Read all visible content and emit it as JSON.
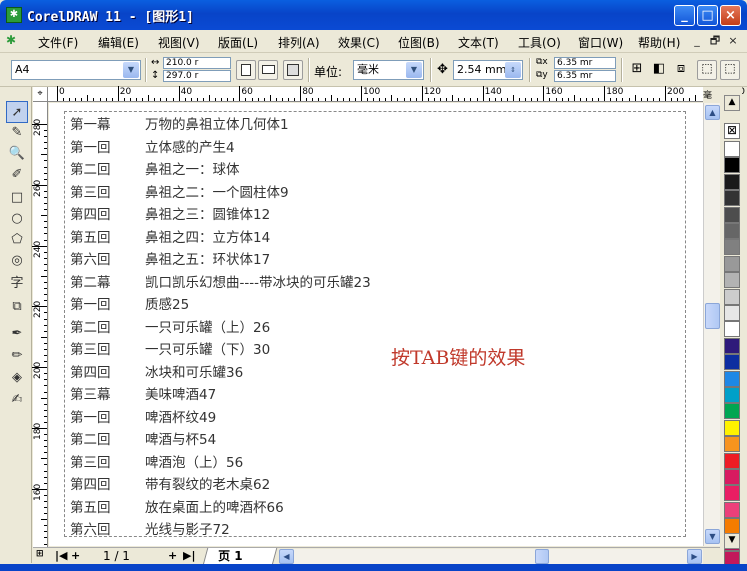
{
  "window": {
    "title": "CorelDRAW 11 - [图形1]",
    "app_icon": "coreldraw-icon",
    "min": "_",
    "max": "□",
    "close": "×"
  },
  "menu": {
    "items": [
      "文件(F)",
      "编辑(E)",
      "视图(V)",
      "版面(L)",
      "排列(A)",
      "效果(C)",
      "位图(B)",
      "文本(T)",
      "工具(O)",
      "窗口(W)",
      "帮助(H)"
    ],
    "mdi": {
      "min": "_",
      "restore": "🗗",
      "close": "×"
    }
  },
  "propbar": {
    "paper": "A4",
    "width": "210.0 r",
    "height": "297.0 r",
    "unit_label": "单位:",
    "unit": "毫米",
    "nudge": "2.54 mm",
    "dup_x": "6.35 mr",
    "dup_y": "6.35 mr"
  },
  "ruler": {
    "h_ticks": [
      "0",
      "20",
      "40",
      "60",
      "80",
      "100",
      "120",
      "140",
      "160",
      "180",
      "200",
      "220"
    ],
    "h_unit": "毫米",
    "v_ticks": [
      "280",
      "260",
      "240",
      "220",
      "200",
      "180",
      "160"
    ]
  },
  "document": {
    "lines": [
      {
        "c": "第一幕",
        "t": "万物的鼻祖立体几何体1"
      },
      {
        "c": "第一回",
        "t": "立体感的产生4"
      },
      {
        "c": "第二回",
        "t": "鼻祖之一：球体"
      },
      {
        "c": "第三回",
        "t": "鼻祖之二：一个圆柱体9"
      },
      {
        "c": "第四回",
        "t": "鼻祖之三：圆锥体12"
      },
      {
        "c": "第五回",
        "t": "鼻祖之四：立方体14"
      },
      {
        "c": "第六回",
        "t": "鼻祖之五：环状体17"
      },
      {
        "c": "第二幕",
        "t": "凯口凯乐幻想曲----带冰块的可乐罐23"
      },
      {
        "c": "第一回",
        "t": "质感25"
      },
      {
        "c": "第二回",
        "t": "一只可乐罐（上）26"
      },
      {
        "c": "第三回",
        "t": "一只可乐罐（下）30"
      },
      {
        "c": "第四回",
        "t": "冰块和可乐罐36"
      },
      {
        "c": "第三幕",
        "t": "美味啤酒47"
      },
      {
        "c": "第一回",
        "t": "啤酒杯纹49"
      },
      {
        "c": "第二回",
        "t": "啤酒与杯54"
      },
      {
        "c": "第三回",
        "t": "啤酒泡（上）56"
      },
      {
        "c": "第四回",
        "t": "带有裂纹的老木桌62"
      },
      {
        "c": "第五回",
        "t": "放在桌面上的啤酒杯66"
      },
      {
        "c": "第六回",
        "t": "光线与影子72"
      }
    ],
    "annotation": "按TAB键的效果"
  },
  "pages": {
    "current": "1 / 1",
    "tab": "页 1"
  },
  "palette": [
    "#ffffff",
    "#000000",
    "#1a1a1a",
    "#333333",
    "#4d4d4d",
    "#666666",
    "#808080",
    "#999999",
    "#b3b3b3",
    "#cccccc",
    "#e6e6e6",
    "#ffffff",
    "#2e1a7a",
    "#0d2ea0",
    "#1e88e5",
    "#00a0c8",
    "#00a651",
    "#fff200",
    "#f7941d",
    "#ed1c24",
    "#d81b60",
    "#e91e63",
    "#ec407a",
    "#f57c00",
    "#ad1457",
    "#c2185b",
    "#b8b8d8"
  ]
}
